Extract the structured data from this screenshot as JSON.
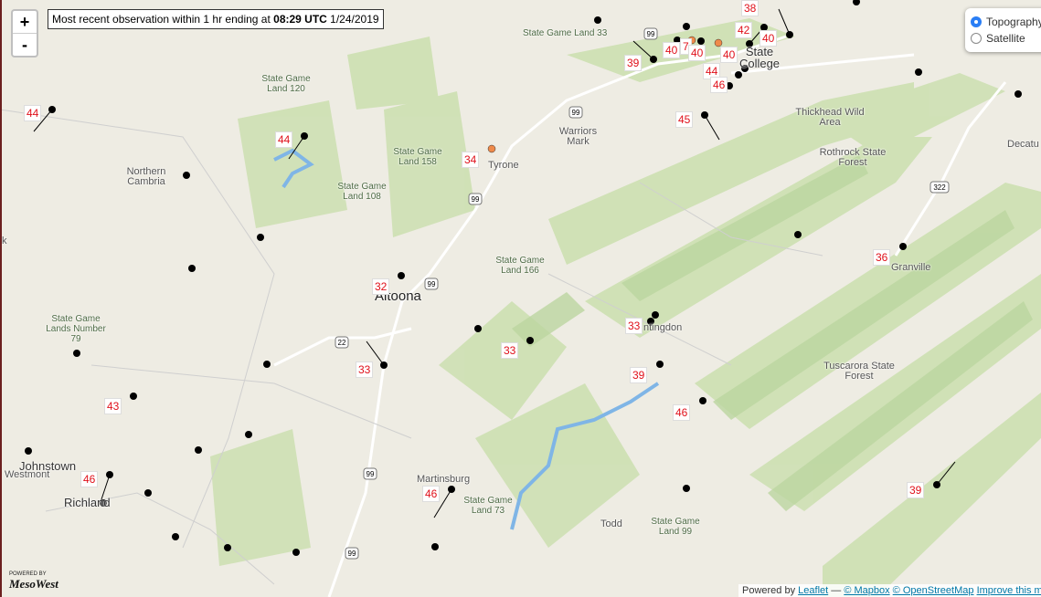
{
  "info_box": {
    "prefix": "Most recent observation within 1 hr ending at ",
    "time": "08:29 UTC",
    "date": " 1/24/2019"
  },
  "zoom": {
    "in_label": "+",
    "out_label": "-"
  },
  "layers": [
    {
      "label": "Topography",
      "selected": true
    },
    {
      "label": "Satellite",
      "selected": false
    }
  ],
  "attribution": {
    "powered": "Powered by ",
    "leaflet": "Leaflet",
    "dash": " — ",
    "mapbox": "© Mapbox",
    "osm": "© OpenStreetMap",
    "improve": "Improve this map"
  },
  "logo": {
    "powered_by": "POWERED BY",
    "brand": "MesoWest"
  },
  "places": [
    {
      "id": "state-game-land-33",
      "text": "State Game Land 33"
    },
    {
      "id": "state-game-land-120",
      "text": "State Game Land 120"
    },
    {
      "id": "warriors-mark",
      "text": "Warriors Mark"
    },
    {
      "id": "state-college",
      "text": "State College"
    },
    {
      "id": "thickhead-wild-area",
      "text": "Thickhead Wild Area"
    },
    {
      "id": "rothrock-state-forest",
      "text": "Rothrock State Forest"
    },
    {
      "id": "decatur",
      "text": "Decatu"
    },
    {
      "id": "northern-cambria",
      "text": "Northern Cambria"
    },
    {
      "id": "state-game-land-158",
      "text": "State Game Land 158"
    },
    {
      "id": "tyrone",
      "text": "Tyrone"
    },
    {
      "id": "state-game-land-108",
      "text": "State Game Land 108"
    },
    {
      "id": "granville",
      "text": "Granville"
    },
    {
      "id": "state-game-land-166",
      "text": "State Game Land 166"
    },
    {
      "id": "altoona",
      "text": "Altoona"
    },
    {
      "id": "state-game-lands-79",
      "text": "State Game Lands Number 79"
    },
    {
      "id": "huntingdon",
      "text": "ntingdon"
    },
    {
      "id": "tuscarora-state-forest",
      "text": "Tuscarora State Forest"
    },
    {
      "id": "johnstown",
      "text": "Johnstown"
    },
    {
      "id": "westmont",
      "text": "Westmont"
    },
    {
      "id": "richland",
      "text": "Richland"
    },
    {
      "id": "martinsburg",
      "text": "Martinsburg"
    },
    {
      "id": "state-game-land-73",
      "text": "State Game Land 73"
    },
    {
      "id": "todd",
      "text": "Todd"
    },
    {
      "id": "state-game-land-99",
      "text": "State Game Land 99"
    },
    {
      "id": "edge-k",
      "text": "k"
    }
  ],
  "route_shields": [
    "99",
    "99",
    "99",
    "99",
    "99",
    "99",
    "22",
    "322"
  ],
  "temperatures": [
    {
      "id": "t-38",
      "value": "38"
    },
    {
      "id": "t-42",
      "value": "42"
    },
    {
      "id": "t-40a",
      "value": "40"
    },
    {
      "id": "t-39a",
      "value": "39"
    },
    {
      "id": "t-40b",
      "value": "40"
    },
    {
      "id": "t-7",
      "value": "7"
    },
    {
      "id": "t-40c",
      "value": "40"
    },
    {
      "id": "t-40d",
      "value": "40"
    },
    {
      "id": "t-44a",
      "value": "44"
    },
    {
      "id": "t-46a",
      "value": "46"
    },
    {
      "id": "t-45",
      "value": "45"
    },
    {
      "id": "t-44b",
      "value": "44"
    },
    {
      "id": "t-44c",
      "value": "44"
    },
    {
      "id": "t-34",
      "value": "34"
    },
    {
      "id": "t-36",
      "value": "36"
    },
    {
      "id": "t-32",
      "value": "32"
    },
    {
      "id": "t-33a",
      "value": "33"
    },
    {
      "id": "t-33b",
      "value": "33"
    },
    {
      "id": "t-33c",
      "value": "33"
    },
    {
      "id": "t-39b",
      "value": "39"
    },
    {
      "id": "t-43",
      "value": "43"
    },
    {
      "id": "t-46b",
      "value": "46"
    },
    {
      "id": "t-46c",
      "value": "46"
    },
    {
      "id": "t-46d",
      "value": "46"
    },
    {
      "id": "t-39c",
      "value": "39"
    }
  ],
  "colors": {
    "station": "#000000",
    "station_alt": "#ef8a4a",
    "temp_text": "#e0101a",
    "water": "#7fb5e6",
    "forest": "#cfe0b5"
  }
}
